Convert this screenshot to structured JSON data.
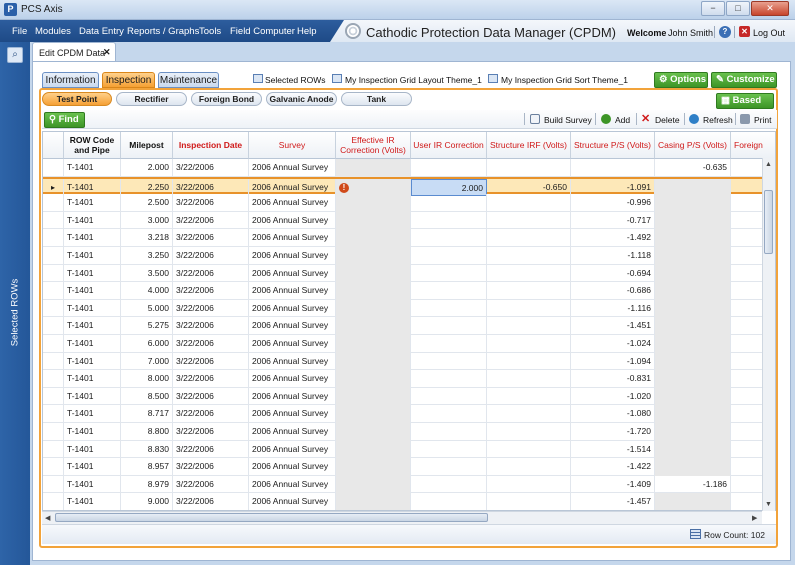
{
  "window": {
    "title": "PCS Axis",
    "min": "−",
    "max": "□",
    "close": "✕"
  },
  "menu": [
    "File",
    "Modules",
    "Data Entry",
    "Reports / Graphs",
    "Tools",
    "Field Computer",
    "Help"
  ],
  "app_title": "Cathodic Protection Data Manager (CPDM)",
  "user": {
    "welcome": "Welcome",
    "name": "John Smith",
    "logout": "Log Out"
  },
  "left_panel": {
    "label": "Selected ROWs",
    "search_icon": "search-icon"
  },
  "doc_tab": {
    "label": "Edit CPDM Data",
    "close": "✕"
  },
  "main_tabs": [
    {
      "label": "Information",
      "active": false
    },
    {
      "label": "Inspection",
      "active": true
    },
    {
      "label": "Maintenance",
      "active": false
    }
  ],
  "top_links": {
    "selected_rows": "Selected ROWs",
    "layout_theme": "My Inspection Grid Layout Theme_1",
    "sort_theme": "My Inspection Grid Sort Theme_1"
  },
  "options_label": "Options",
  "customize_label": "Customize",
  "based_on_label": "Based On",
  "sub_tabs": [
    {
      "label": "Test Point",
      "active": true
    },
    {
      "label": "Rectifier",
      "active": false
    },
    {
      "label": "Foreign Bond",
      "active": false
    },
    {
      "label": "Galvanic Anode",
      "active": false
    },
    {
      "label": "Tank",
      "active": false
    }
  ],
  "find_label": "Find",
  "toolbar": {
    "build_survey": "Build Survey",
    "add": "Add",
    "delete": "Delete",
    "refresh": "Refresh",
    "print": "Print"
  },
  "columns": [
    "ROW Code and Pipe",
    "Milepost",
    "Inspection Date",
    "Survey",
    "Effective IR Correction (Volts)",
    "User IR Correction",
    "Structure IRF (Volts)",
    "Structure P/S (Volts)",
    "Casing P/S (Volts)",
    "Foreign"
  ],
  "rows": [
    {
      "row": "T-1401",
      "milepost": "2.000",
      "date": "3/22/2006",
      "survey": "2006 Annual Survey",
      "user_ir": "",
      "irf": "",
      "ps": "",
      "casing": "-0.635",
      "selected": false,
      "warn": false
    },
    {
      "row": "T-1401",
      "milepost": "2.250",
      "date": "3/22/2006",
      "survey": "2006 Annual Survey",
      "user_ir": "2.000",
      "irf": "-0.650",
      "ps": "-1.091",
      "casing": "",
      "selected": true,
      "warn": true
    },
    {
      "row": "T-1401",
      "milepost": "2.500",
      "date": "3/22/2006",
      "survey": "2006 Annual Survey",
      "user_ir": "",
      "irf": "",
      "ps": "-0.996",
      "casing": "",
      "selected": false,
      "warn": false
    },
    {
      "row": "T-1401",
      "milepost": "3.000",
      "date": "3/22/2006",
      "survey": "2006 Annual Survey",
      "user_ir": "",
      "irf": "",
      "ps": "-0.717",
      "casing": "",
      "selected": false,
      "warn": false
    },
    {
      "row": "T-1401",
      "milepost": "3.218",
      "date": "3/22/2006",
      "survey": "2006 Annual Survey",
      "user_ir": "",
      "irf": "",
      "ps": "-1.492",
      "casing": "",
      "selected": false,
      "warn": false
    },
    {
      "row": "T-1401",
      "milepost": "3.250",
      "date": "3/22/2006",
      "survey": "2006 Annual Survey",
      "user_ir": "",
      "irf": "",
      "ps": "-1.118",
      "casing": "",
      "selected": false,
      "warn": false
    },
    {
      "row": "T-1401",
      "milepost": "3.500",
      "date": "3/22/2006",
      "survey": "2006 Annual Survey",
      "user_ir": "",
      "irf": "",
      "ps": "-0.694",
      "casing": "",
      "selected": false,
      "warn": false
    },
    {
      "row": "T-1401",
      "milepost": "4.000",
      "date": "3/22/2006",
      "survey": "2006 Annual Survey",
      "user_ir": "",
      "irf": "",
      "ps": "-0.686",
      "casing": "",
      "selected": false,
      "warn": false
    },
    {
      "row": "T-1401",
      "milepost": "5.000",
      "date": "3/22/2006",
      "survey": "2006 Annual Survey",
      "user_ir": "",
      "irf": "",
      "ps": "-1.116",
      "casing": "",
      "selected": false,
      "warn": false
    },
    {
      "row": "T-1401",
      "milepost": "5.275",
      "date": "3/22/2006",
      "survey": "2006 Annual Survey",
      "user_ir": "",
      "irf": "",
      "ps": "-1.451",
      "casing": "",
      "selected": false,
      "warn": false
    },
    {
      "row": "T-1401",
      "milepost": "6.000",
      "date": "3/22/2006",
      "survey": "2006 Annual Survey",
      "user_ir": "",
      "irf": "",
      "ps": "-1.024",
      "casing": "",
      "selected": false,
      "warn": false
    },
    {
      "row": "T-1401",
      "milepost": "7.000",
      "date": "3/22/2006",
      "survey": "2006 Annual Survey",
      "user_ir": "",
      "irf": "",
      "ps": "-1.094",
      "casing": "",
      "selected": false,
      "warn": false
    },
    {
      "row": "T-1401",
      "milepost": "8.000",
      "date": "3/22/2006",
      "survey": "2006 Annual Survey",
      "user_ir": "",
      "irf": "",
      "ps": "-0.831",
      "casing": "",
      "selected": false,
      "warn": false
    },
    {
      "row": "T-1401",
      "milepost": "8.500",
      "date": "3/22/2006",
      "survey": "2006 Annual Survey",
      "user_ir": "",
      "irf": "",
      "ps": "-1.020",
      "casing": "",
      "selected": false,
      "warn": false
    },
    {
      "row": "T-1401",
      "milepost": "8.717",
      "date": "3/22/2006",
      "survey": "2006 Annual Survey",
      "user_ir": "",
      "irf": "",
      "ps": "-1.080",
      "casing": "",
      "selected": false,
      "warn": false
    },
    {
      "row": "T-1401",
      "milepost": "8.800",
      "date": "3/22/2006",
      "survey": "2006 Annual Survey",
      "user_ir": "",
      "irf": "",
      "ps": "-1.720",
      "casing": "",
      "selected": false,
      "warn": false
    },
    {
      "row": "T-1401",
      "milepost": "8.830",
      "date": "3/22/2006",
      "survey": "2006 Annual Survey",
      "user_ir": "",
      "irf": "",
      "ps": "-1.514",
      "casing": "",
      "selected": false,
      "warn": false
    },
    {
      "row": "T-1401",
      "milepost": "8.957",
      "date": "3/22/2006",
      "survey": "2006 Annual Survey",
      "user_ir": "",
      "irf": "",
      "ps": "-1.422",
      "casing": "",
      "selected": false,
      "warn": false
    },
    {
      "row": "T-1401",
      "milepost": "8.979",
      "date": "3/22/2006",
      "survey": "2006 Annual Survey",
      "user_ir": "",
      "irf": "",
      "ps": "-1.409",
      "casing": "-1.186",
      "selected": false,
      "warn": false
    },
    {
      "row": "T-1401",
      "milepost": "9.000",
      "date": "3/22/2006",
      "survey": "2006 Annual Survey",
      "user_ir": "",
      "irf": "",
      "ps": "-1.457",
      "casing": "",
      "selected": false,
      "warn": false
    }
  ],
  "status": {
    "row_count": "Row Count: 102"
  },
  "colors": {
    "accent_orange": "#f5a033",
    "menu_blue": "#1e4a86",
    "green": "#3d9527",
    "required_red": "#d01919"
  }
}
